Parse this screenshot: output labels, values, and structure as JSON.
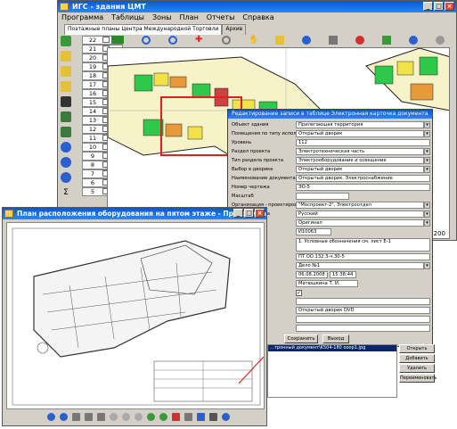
{
  "main_window": {
    "title": "ИГС - здания ЦМТ",
    "menu": [
      "Программа",
      "Таблицы",
      "Зоны",
      "План",
      "Отчеты",
      "Справка"
    ],
    "tabs": [
      "Поэтажные планы Центра Международной Торговли",
      "Архив"
    ],
    "floors": [
      "22",
      "21",
      "20",
      "19",
      "18",
      "17",
      "16",
      "15",
      "14",
      "13",
      "12",
      "11",
      "10",
      "9",
      "8",
      "7",
      "6",
      "5"
    ],
    "scale_label": "200"
  },
  "dialog": {
    "title": "Редактирование записи в таблице Электронная карточка документа",
    "fields": [
      {
        "label": "Объект здания",
        "value": "Прилегающая территория",
        "dropdown": true
      },
      {
        "label": "Помещения по типу использования",
        "value": "Открытый дворик",
        "dropdown": true
      },
      {
        "label": "Уровень",
        "value": "112",
        "dropdown": false
      },
      {
        "label": "Раздел проекта",
        "value": "Электротехническая часть",
        "dropdown": true
      },
      {
        "label": "Тип раздела проекта",
        "value": "Электрооборудование и освещение",
        "dropdown": true
      },
      {
        "label": "Выбор в дворике",
        "value": "Открытый дворик",
        "dropdown": true
      },
      {
        "label": "Наименование документа",
        "value": "Открытый дворик. Электроснабжение",
        "dropdown": false
      },
      {
        "label": "Номер чертежа",
        "value": "ЭО-5",
        "dropdown": false
      },
      {
        "label": "Масштаб",
        "value": "",
        "dropdown": false
      },
      {
        "label": "Организация - проектировщик",
        "value": "\"Моспроект-2\", Электроотдел",
        "dropdown": true
      },
      {
        "label": "…ного чертежа",
        "value": "Русский",
        "dropdown": true
      },
      {
        "label": "…ипеточника",
        "value": "Оригинал",
        "dropdown": true
      },
      {
        "label": "",
        "value": "И10063",
        "dropdown": false
      },
      {
        "label": "",
        "value": "1. Условные обозначения см. лист Е-1",
        "dropdown": false
      },
      {
        "label": "…ионной ния",
        "value": "ПТ.ОО.132.3-ч.30-5",
        "dropdown": false
      },
      {
        "label": "",
        "value": "Дело №1",
        "dropdown": true
      },
      {
        "label": "…архив",
        "value": "06.08.2008",
        "dropdown": false
      },
      {
        "label": "",
        "value": "Матюшкина Т. И.",
        "dropdown": false
      }
    ],
    "time_value": "15:38:44",
    "extra_labels": [
      "…та",
      "…ия таба:",
      "…DVD",
      "…рх",
      "…ые"
    ],
    "extra_values": [
      "Открытый дворик DVD"
    ],
    "save_label": "Сохранить",
    "exit_label": "Выход"
  },
  "attachments": {
    "selected": "…тронный документ\\K504-180 ooop1.jpg"
  },
  "side_buttons": [
    "Открыть",
    "Добавить",
    "Удалить",
    "Переименовать"
  ],
  "viewer_window": {
    "title": "План расположения оборудования на пятом этаже - Программа просмотра и..."
  },
  "colors": {
    "title_blue": "#0a58d0",
    "plan_green": "#2ec94a",
    "plan_yellow": "#f2e24a",
    "plan_red": "#e02020"
  }
}
